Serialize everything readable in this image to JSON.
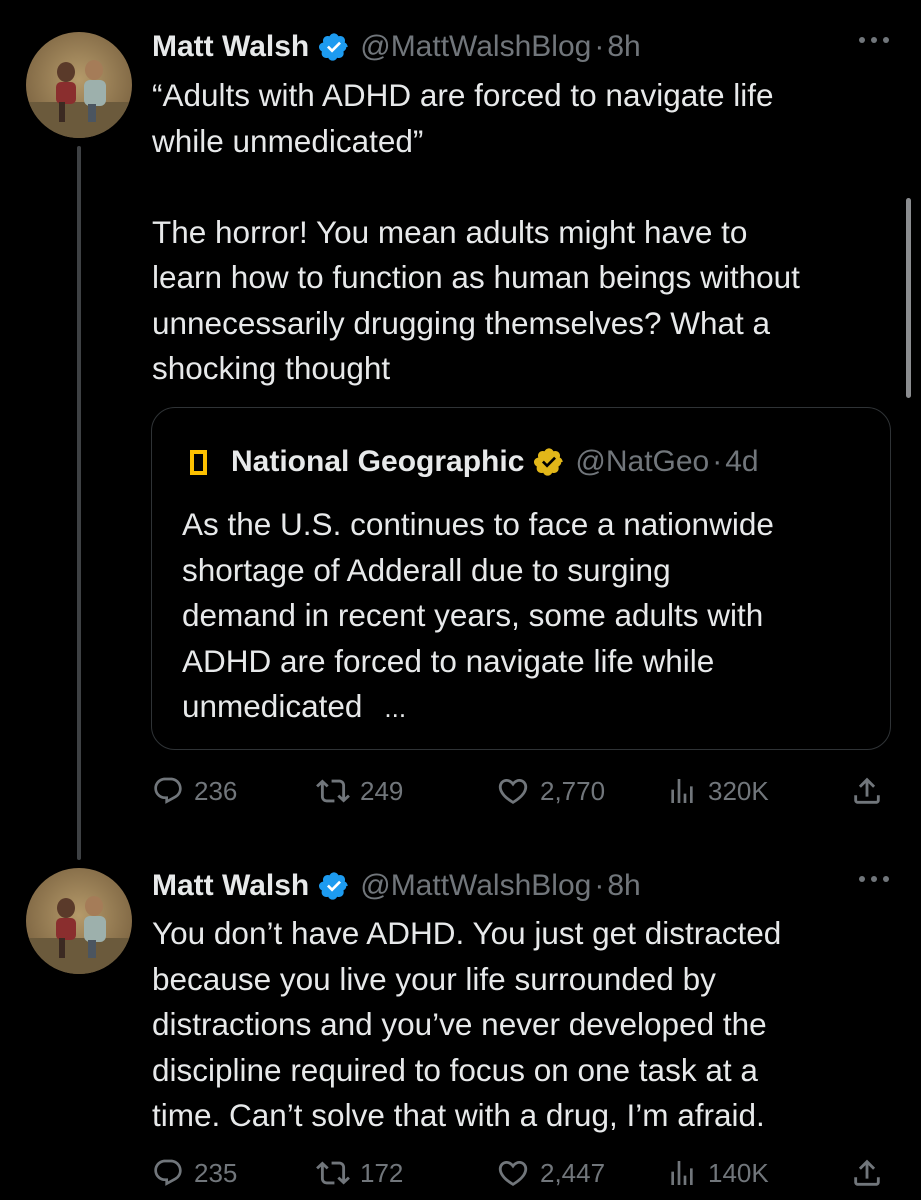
{
  "tweets": [
    {
      "author": "Matt Walsh",
      "handle": "@MattWalshBlog",
      "separator": "·",
      "time": "8h",
      "text": "“Adults with ADHD are forced to navigate life\nwhile unmedicated”\n\nThe horror! You mean adults might have to\nlearn how to function as human beings without\nunnecessarily drugging themselves? What a\nshocking thought",
      "replies": "236",
      "retweets": "249",
      "likes": "2,770",
      "views": "320K"
    },
    {
      "author": "Matt Walsh",
      "handle": "@MattWalshBlog",
      "separator": "·",
      "time": "8h",
      "text": "You don’t have ADHD. You just get distracted\nbecause you live your life surrounded by\ndistractions and you’ve never developed the\ndiscipline required to focus on one task at a\ntime. Can’t solve that with a drug, I’m afraid.",
      "replies": "235",
      "retweets": "172",
      "likes": "2,447",
      "views": "140K"
    }
  ],
  "quote": {
    "author": "National Geographic",
    "handle": "@NatGeo",
    "separator": "·",
    "time": "4d",
    "text": "As the U.S. continues to face a nationwide\nshortage of Adderall due to surging\ndemand in recent years, some adults with\nADHD are forced to navigate life while\nunmedicated",
    "ellipsis": "..."
  },
  "colors": {
    "background": "#000000",
    "text": "#e7e9ea",
    "muted": "#71767b",
    "verified_blue": "#1d9bf0",
    "verified_gold": "#e2b719",
    "natgeo_yellow": "#fcc000"
  },
  "icons": {
    "reply": "reply-icon",
    "retweet": "retweet-icon",
    "like": "heart-icon",
    "views": "views-icon",
    "share": "share-icon",
    "more": "more-icon",
    "verified": "verified-badge-icon"
  }
}
